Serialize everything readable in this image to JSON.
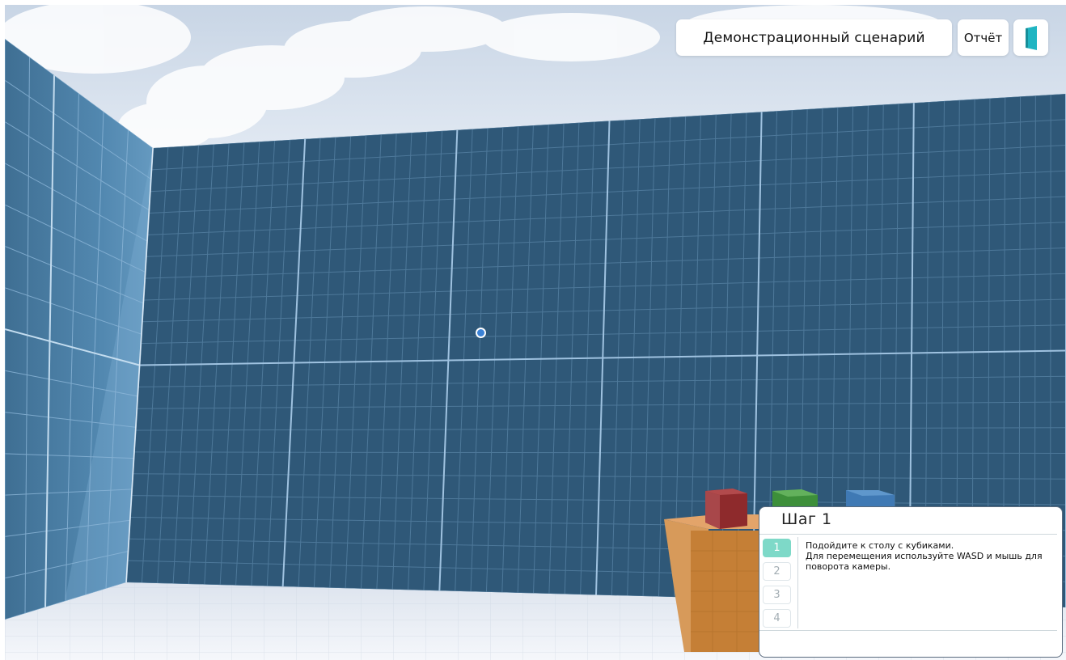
{
  "hud": {
    "scenario_title": "Демонстрационный сценарий",
    "report_label": "Отчёт",
    "exit_icon": "door-exit-icon"
  },
  "step_panel": {
    "title": "Шаг 1",
    "tabs": [
      "1",
      "2",
      "3",
      "4"
    ],
    "active_tab": 0,
    "lines": [
      "Подойдите к столу с кубиками.",
      "Для перемещения используйте WASD и мышь для поворота камеры."
    ]
  },
  "scene": {
    "crosshair_icon": "crosshair-icon",
    "colors": {
      "accent": "#7ed9c8",
      "wall": "#2f5878",
      "cube_red": "#8e2a2c",
      "cube_green": "#3d8f3a",
      "cube_blue": "#3f79b4",
      "table": "#c57f36"
    }
  }
}
